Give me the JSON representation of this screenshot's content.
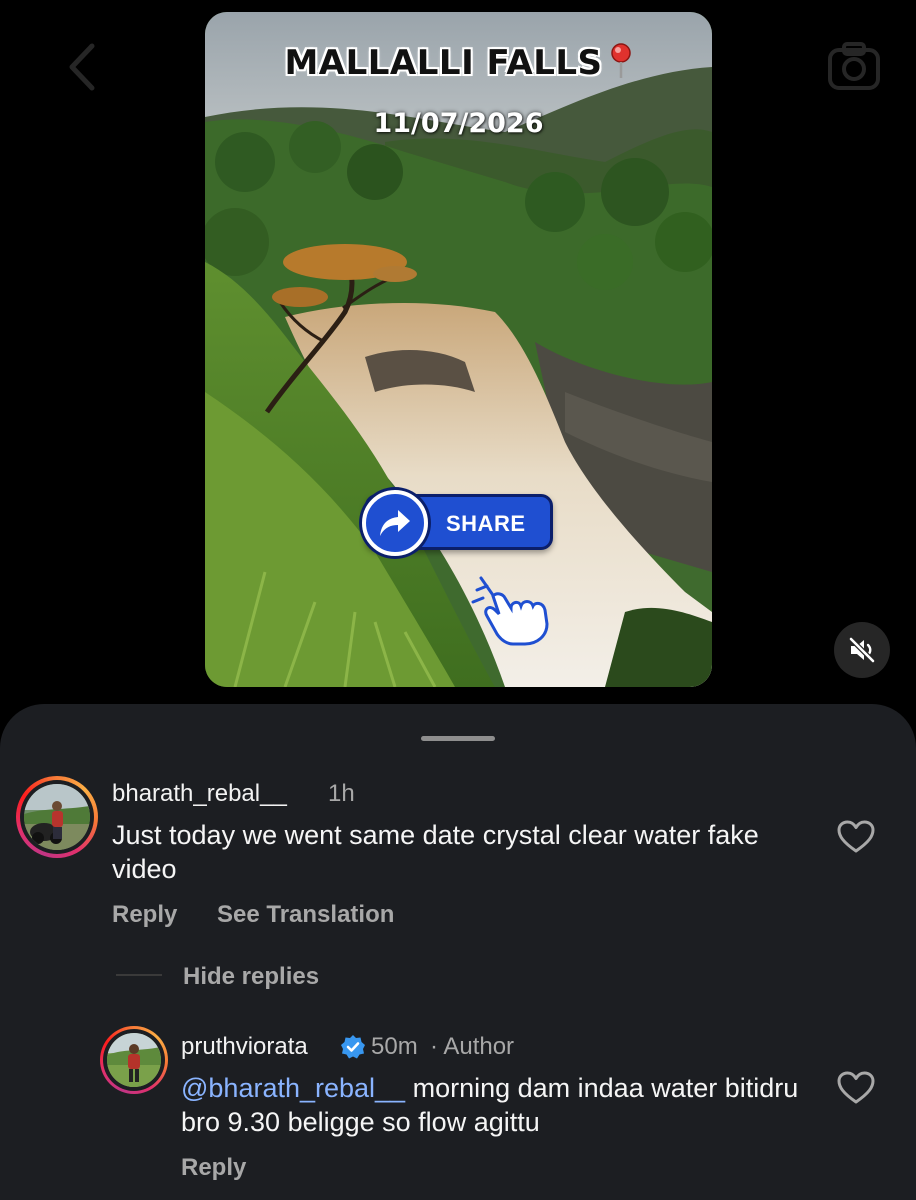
{
  "media": {
    "title": "MALLALLI FALLS",
    "date": "11/07/2026",
    "share_label": "SHARE"
  },
  "comments": [
    {
      "username": "bharath_rebal__",
      "time": "1h",
      "text": "Just today we went same date crystal clear water fake video",
      "reply_label": "Reply",
      "translate_label": "See Translation"
    }
  ],
  "replies_toggle": "Hide replies",
  "replies": [
    {
      "username": "pruthviorata",
      "time": "50m",
      "role": "· Author",
      "mention": "@bharath_rebal__",
      "text": " morning dam indaa water bitidru bro 9.30 beligge so flow agittu",
      "reply_label": "Reply"
    }
  ],
  "icons": {
    "back": "chevron-left-icon",
    "camera": "camera-icon",
    "pin": "map-pin-icon",
    "share": "share-arrow-icon",
    "hand": "pointing-hand-icon",
    "mute": "speaker-muted-icon",
    "like": "heart-icon",
    "verified": "verified-badge-icon"
  },
  "colors": {
    "sheet_bg": "#1c1e22",
    "mention": "#8ab4ff",
    "verified": "#3897f0",
    "share_button": "#1f4fd1"
  }
}
